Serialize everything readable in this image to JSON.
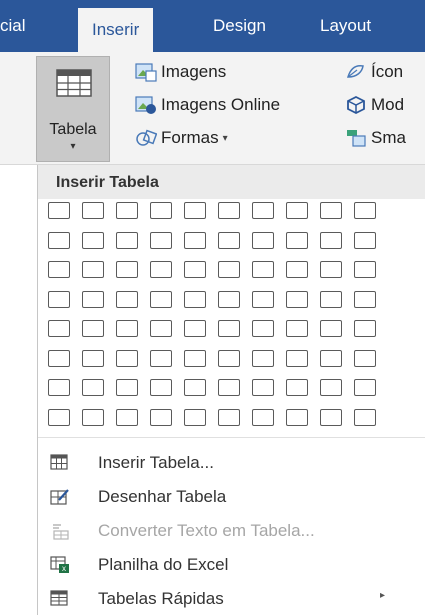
{
  "ribbon_tabs": {
    "home_partial": "cial",
    "insert": "Inserir",
    "design": "Design",
    "layout": "Layout"
  },
  "ribbon": {
    "table_button": {
      "label": "Tabela",
      "chevron": "▾"
    },
    "images": "Imagens",
    "online_images": "Imagens Online",
    "shapes": "Formas",
    "shapes_chevron": "▾",
    "icons_partial": "Ícon",
    "models_partial": "Mod",
    "smartart_partial": "Sma"
  },
  "dropdown": {
    "header": "Inserir Tabela",
    "grid": {
      "columns": 10,
      "rows": 8
    },
    "items": [
      {
        "label": "Inserir Tabela...",
        "icon": "table-icon",
        "disabled": false
      },
      {
        "label": "Desenhar Tabela",
        "icon": "draw-table-icon",
        "disabled": false
      },
      {
        "label": "Converter Texto em Tabela...",
        "icon": "convert-text-icon",
        "disabled": true
      },
      {
        "label": "Planilha do Excel",
        "icon": "excel-icon",
        "disabled": false
      },
      {
        "label": "Tabelas Rápidas",
        "icon": "quick-tables-icon",
        "disabled": false,
        "submenu_arrow": "▸"
      }
    ]
  },
  "colors": {
    "ribbon_blue": "#2b579a",
    "ribbon_bg": "#f3f3f3",
    "disabled_text": "#a6a6a6"
  }
}
